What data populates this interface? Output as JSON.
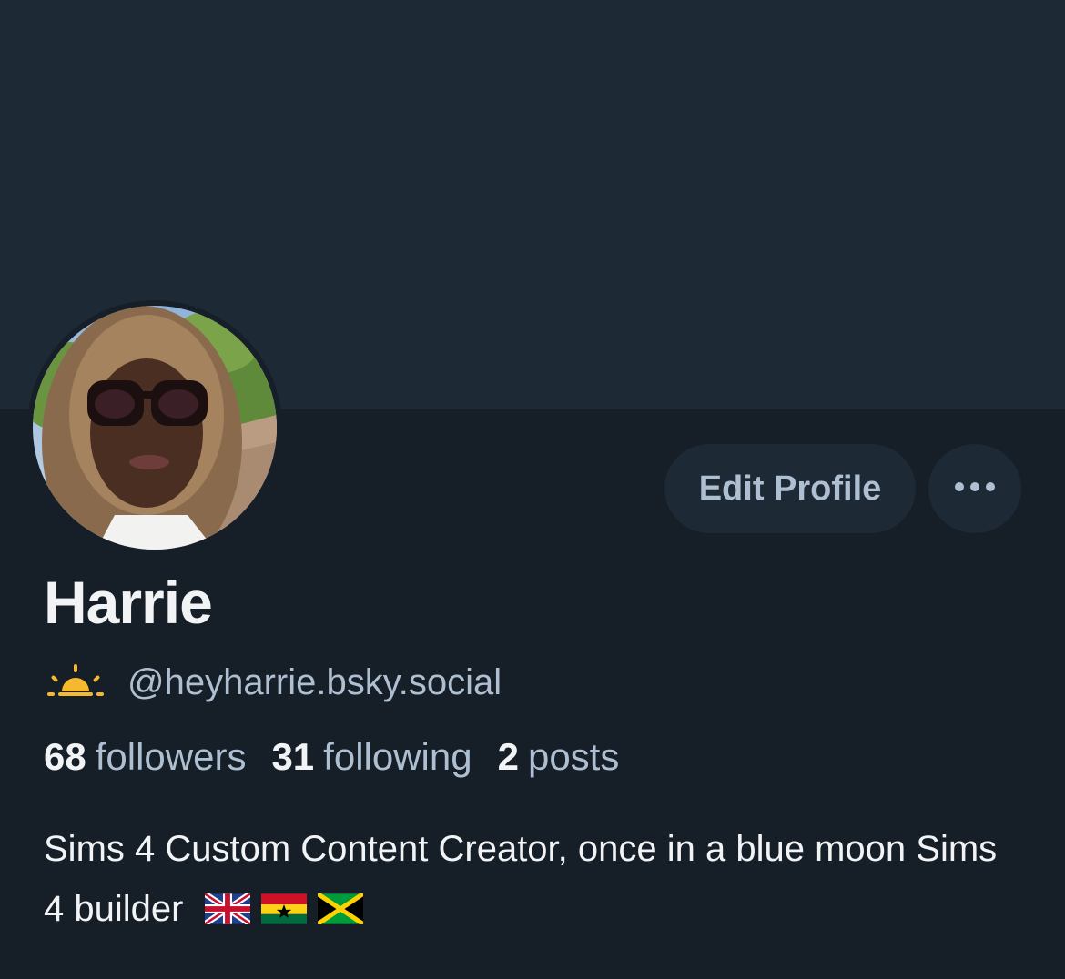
{
  "profile": {
    "display_name": "Harrie",
    "handle": "@heyharrie.bsky.social",
    "status_icon": "sun-icon",
    "avatar_icon": "profile-photo"
  },
  "actions": {
    "edit_label": "Edit Profile",
    "more_icon": "more-horizontal-icon"
  },
  "stats": [
    {
      "value": "68",
      "label": "followers"
    },
    {
      "value": "31",
      "label": "following"
    },
    {
      "value": "2",
      "label": "posts"
    }
  ],
  "bio": {
    "text": "Sims 4 Custom Content Creator, once in a blue moon Sims 4 builder",
    "flags": [
      "uk-flag-icon",
      "ghana-flag-icon",
      "jamaica-flag-icon"
    ]
  },
  "colors": {
    "banner": "#1e2936",
    "background": "#161e27",
    "button_bg": "#1e2936",
    "muted_text": "#aebfd1",
    "primary_text": "#f1f3f5",
    "sun": "#f5b82e"
  }
}
